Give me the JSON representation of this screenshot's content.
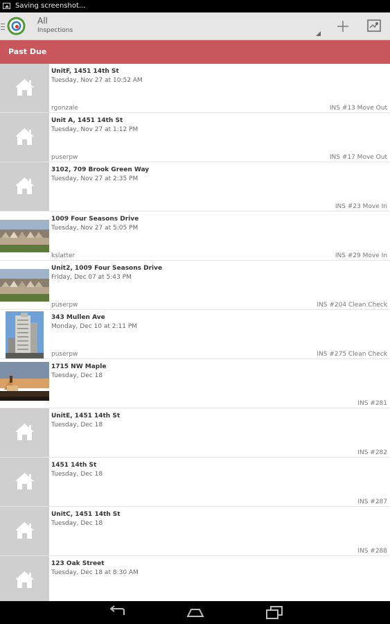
{
  "status_bar": {
    "text": "Saving screenshot..."
  },
  "action_bar": {
    "title": "All",
    "subtitle": "Inspections",
    "add_icon": "plus-icon",
    "map_icon": "map-icon"
  },
  "section": {
    "label": "Past Due"
  },
  "inspections": [
    {
      "address": "UnitF, 1451 14th St",
      "datetime": "Tuesday, Nov 27 at 10:52 AM",
      "user": "rgonzale",
      "code": "INS #13 Move Out",
      "thumb": "house-icon"
    },
    {
      "address": "Unit A, 1451 14th St",
      "datetime": "Tuesday, Nov 27 at 1:12 PM",
      "user": "puserpw",
      "code": "INS #17 Move Out",
      "thumb": "house-icon"
    },
    {
      "address": "3102, 709 Brook Green Way",
      "datetime": "Tuesday, Nov 27 at 2:35 PM",
      "user": "",
      "code": "INS #23 Move In",
      "thumb": "house-icon"
    },
    {
      "address": "1009 Four Seasons Drive",
      "datetime": "Tuesday, Nov 27 at 5:05 PM",
      "user": "kslatter",
      "code": "INS #29 Move In",
      "thumb": "row-houses-photo"
    },
    {
      "address": "Unit2, 1009 Four Seasons Drive",
      "datetime": "Friday, Dec 07 at 5:43 PM",
      "user": "puserpw",
      "code": "INS #204 Clean Check",
      "thumb": "row-houses-photo"
    },
    {
      "address": "343 Mullen Ave",
      "datetime": "Monday, Dec 10 at 2:11 PM",
      "user": "puserpw",
      "code": "INS #275 Clean Check",
      "thumb": "tower-photo"
    },
    {
      "address": "1715 NW Maple",
      "datetime": "Tuesday, Dec 18",
      "user": "",
      "code": "INS #281",
      "thumb": "sunset-house-photo"
    },
    {
      "address": "UnitE, 1451 14th St",
      "datetime": "Tuesday, Dec 18",
      "user": "",
      "code": "INS #282",
      "thumb": "house-icon"
    },
    {
      "address": "1451 14th St",
      "datetime": "Tuesday, Dec 18",
      "user": "",
      "code": "INS #287",
      "thumb": "house-icon"
    },
    {
      "address": "UnitC, 1451 14th St",
      "datetime": "Tuesday, Dec 18",
      "user": "",
      "code": "INS #288",
      "thumb": "house-icon"
    },
    {
      "address": "123 Oak Street",
      "datetime": "Tuesday, Dec 18 at 8:30 AM",
      "user": "",
      "code": "",
      "thumb": "house-icon"
    }
  ],
  "nav_bar": {
    "back": "back-icon",
    "home": "home-icon",
    "recents": "recents-icon"
  }
}
